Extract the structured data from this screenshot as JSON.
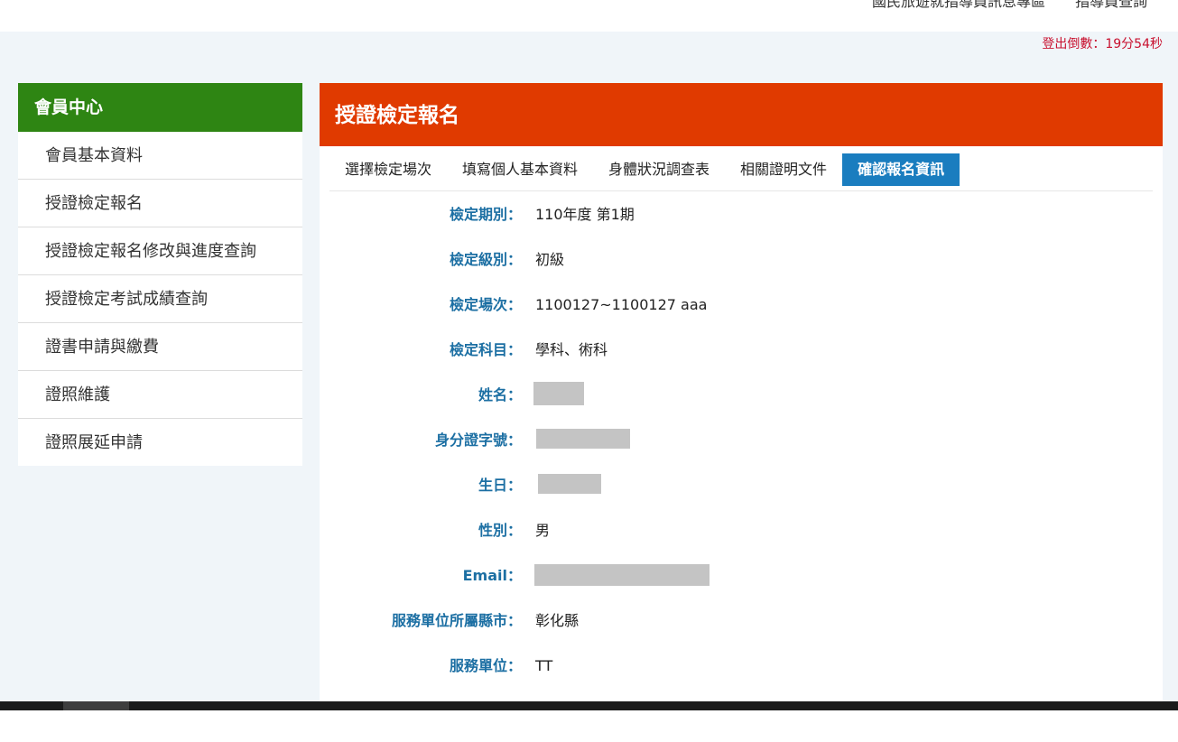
{
  "top_nav": {
    "links": [
      "國民旅遊就指導員訊息專區",
      "指導員查詢"
    ]
  },
  "logout_countdown": "登出倒數：19分54秒",
  "sidebar": {
    "title": "會員中心",
    "items": [
      "會員基本資料",
      "授證檢定報名",
      "授證檢定報名修改與進度查詢",
      "授證檢定考試成績查詢",
      "證書申請與繳費",
      "證照維護",
      "證照展延申請"
    ]
  },
  "main": {
    "title": "授證檢定報名",
    "steps": [
      {
        "label": "選擇檢定場次",
        "active": false
      },
      {
        "label": "填寫個人基本資料",
        "active": false
      },
      {
        "label": "身體狀況調查表",
        "active": false
      },
      {
        "label": "相關證明文件",
        "active": false
      },
      {
        "label": "確認報名資訊",
        "active": true
      }
    ],
    "fields": [
      {
        "label": "檢定期別：",
        "value": "110年度 第1期"
      },
      {
        "label": "檢定級別：",
        "value": "初級"
      },
      {
        "label": "檢定場次：",
        "value": "1100127~1100127 aaa"
      },
      {
        "label": "檢定科目：",
        "value": "學科、術科"
      },
      {
        "label": "姓名：",
        "value": ""
      },
      {
        "label": "身分證字號：",
        "value": ""
      },
      {
        "label": "生日：",
        "value": ""
      },
      {
        "label": "性別：",
        "value": "男"
      },
      {
        "label": "Email：",
        "value": ""
      },
      {
        "label": "服務單位所屬縣市：",
        "value": "彰化縣"
      },
      {
        "label": "服務單位：",
        "value": "TT"
      }
    ]
  },
  "colors": {
    "sidebar_header": "#2e8513",
    "main_header": "#e03a00",
    "active_step": "#1a7dbf",
    "field_label": "#1c6fa3",
    "countdown": "#c8102e",
    "page_background": "#f0f5f9"
  }
}
